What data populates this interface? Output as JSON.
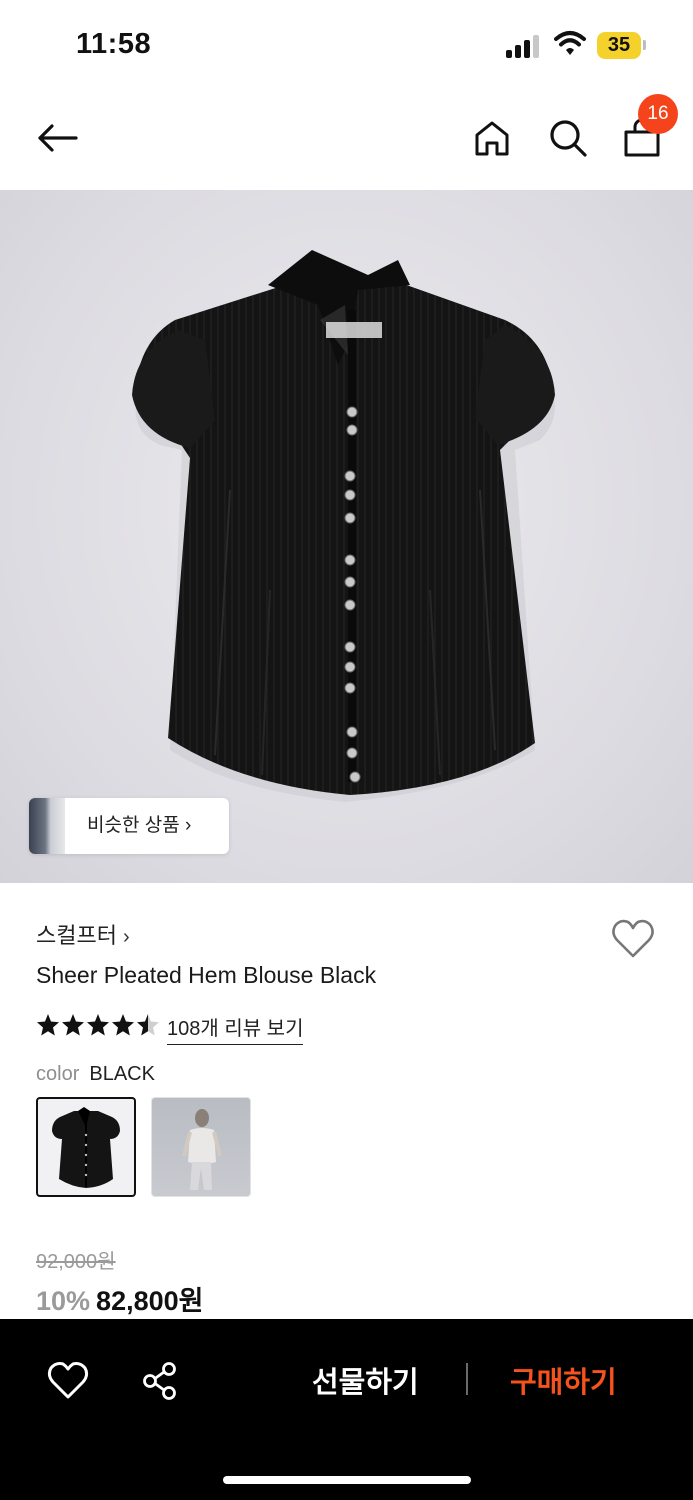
{
  "status_bar": {
    "time": "11:58",
    "battery": "35"
  },
  "nav": {
    "back_icon": "arrow-left-icon",
    "home_icon": "home-icon",
    "search_icon": "search-icon",
    "cart_icon": "shopping-bag-icon",
    "cart_count": "16",
    "badge_color": "#f5431b"
  },
  "hero": {
    "similar_label": "비슷한 상품",
    "similar_chevron": "›"
  },
  "product": {
    "brand": "스컬프터",
    "brand_chevron": "›",
    "name": "Sheer Pleated Hem Blouse Black",
    "rating": 4.5,
    "rating_max": 5,
    "review_link": "108개 리뷰 보기",
    "color_label": "color",
    "color_value": "BLACK",
    "original_price": "92,000원",
    "discount": "10%",
    "sale_price": "82,800원"
  },
  "bottom_bar": {
    "wishlist_icon": "heart-icon",
    "share_icon": "share-icon",
    "gift_label": "선물하기",
    "buy_label": "구매하기",
    "buy_color": "#f5521d"
  }
}
